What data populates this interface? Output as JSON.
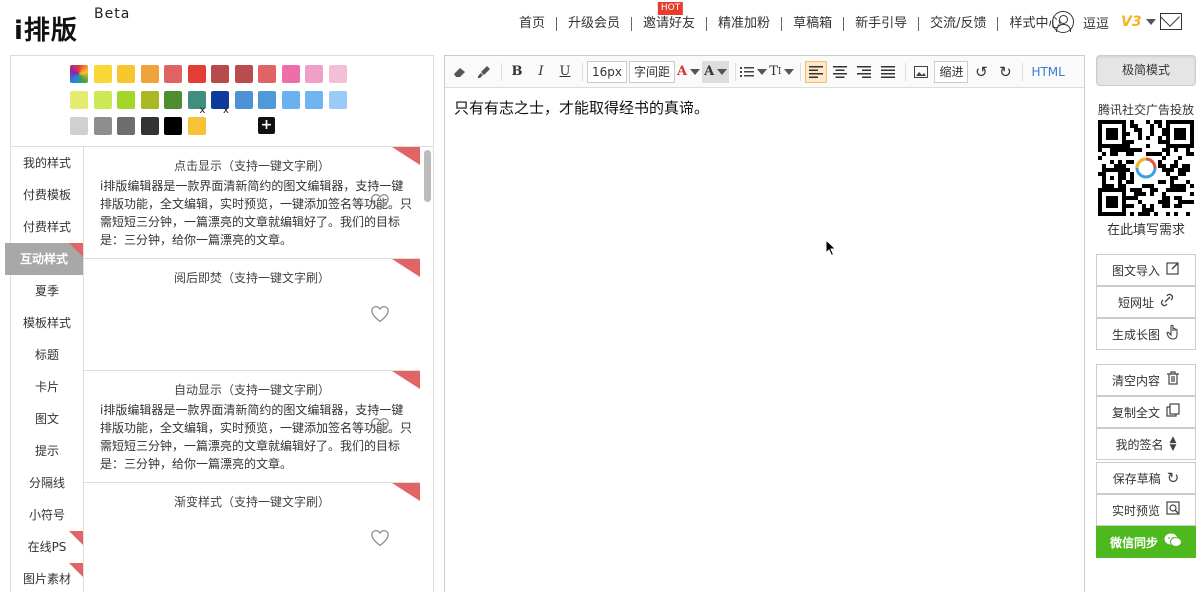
{
  "header": {
    "logo": "i排版",
    "beta": "Beta",
    "nav": [
      {
        "label": "首页"
      },
      {
        "label": "升级会员"
      },
      {
        "label": "邀请好友",
        "badge": "HOT"
      },
      {
        "label": "精准加粉"
      },
      {
        "label": "草稿箱"
      },
      {
        "label": "新手引导"
      },
      {
        "label": "交流/反馈"
      },
      {
        "label": "样式中心"
      }
    ],
    "user_name": "逗逗",
    "vip": "V3"
  },
  "palette": {
    "row1": [
      "#e53935",
      "#f9d835",
      "#f7c62f",
      "#f1a23a",
      "#e06363",
      "#e43d35",
      "#b74a4a",
      "#b94d4d",
      "#e06464",
      "#ee6ea9",
      "#f0a0c7",
      "#f3bfd6"
    ],
    "row2": [
      "#e5ea70",
      "#cce855",
      "#a3d626",
      "#a9b823",
      "#4e8e30",
      "#3e8f7d",
      "#0e3b9c",
      "#4d94d6",
      "#4f98d9",
      "#6ab2ef",
      "#6fb5f2",
      "#99cbf5"
    ],
    "row3": [
      "#d0d0d0",
      "#8e8e8e",
      "#6d6d6d",
      "#333333",
      "#000000",
      "#f7c236"
    ],
    "x_mark": "x",
    "plus": "+"
  },
  "categories": [
    "我的样式",
    "付费模板",
    "付费样式",
    "互动样式",
    "夏季",
    "模板样式",
    "标题",
    "卡片",
    "图文",
    "提示",
    "分隔线",
    "小符号",
    "在线PS",
    "图片素材"
  ],
  "styles": [
    {
      "title": "点击显示（支持一键文字刷）",
      "body": "i排版编辑器是一款界面清新简约的图文编辑器，支持一键排版功能，全文编辑，实时预览，一键添加签名等功能。只需短短三分钟，一篇漂亮的文章就编辑好了。我们的目标是：三分钟，给你一篇漂亮的文章。"
    },
    {
      "title": "阅后即焚（支持一键文字刷）",
      "body": ""
    },
    {
      "title": "自动显示（支持一键文字刷）",
      "body": "i排版编辑器是一款界面清新简约的图文编辑器，支持一键排版功能，全文编辑，实时预览，一键添加签名等功能。只需短短三分钟，一篇漂亮的文章就编辑好了。我们的目标是：三分钟，给你一篇漂亮的文章。"
    },
    {
      "title": "渐变样式（支持一键文字刷）",
      "body": ""
    }
  ],
  "toolbar": {
    "font_size": "16px",
    "letter_spacing": "字间距",
    "indent": "缩进",
    "html": "HTML"
  },
  "editor": {
    "content": "只有有志之士，才能取得经书的真谛。"
  },
  "right": {
    "mode": "极简模式",
    "ad_title": "腾讯社交广告投放",
    "ad_sub": "在此填写需求",
    "buttons": [
      {
        "label": "图文导入",
        "icon": "edit-icon"
      },
      {
        "label": "短网址",
        "icon": "link-icon"
      },
      {
        "label": "生成长图",
        "icon": "hand-icon"
      },
      {
        "label": "清空内容",
        "icon": "trash-icon"
      },
      {
        "label": "复制全文",
        "icon": "copy-icon"
      },
      {
        "label": "我的签名",
        "icon": "sort-icon"
      },
      {
        "label": "保存草稿",
        "icon": "refresh-icon"
      },
      {
        "label": "实时预览",
        "icon": "preview-icon"
      },
      {
        "label": "微信同步",
        "icon": "wechat-icon"
      }
    ]
  }
}
